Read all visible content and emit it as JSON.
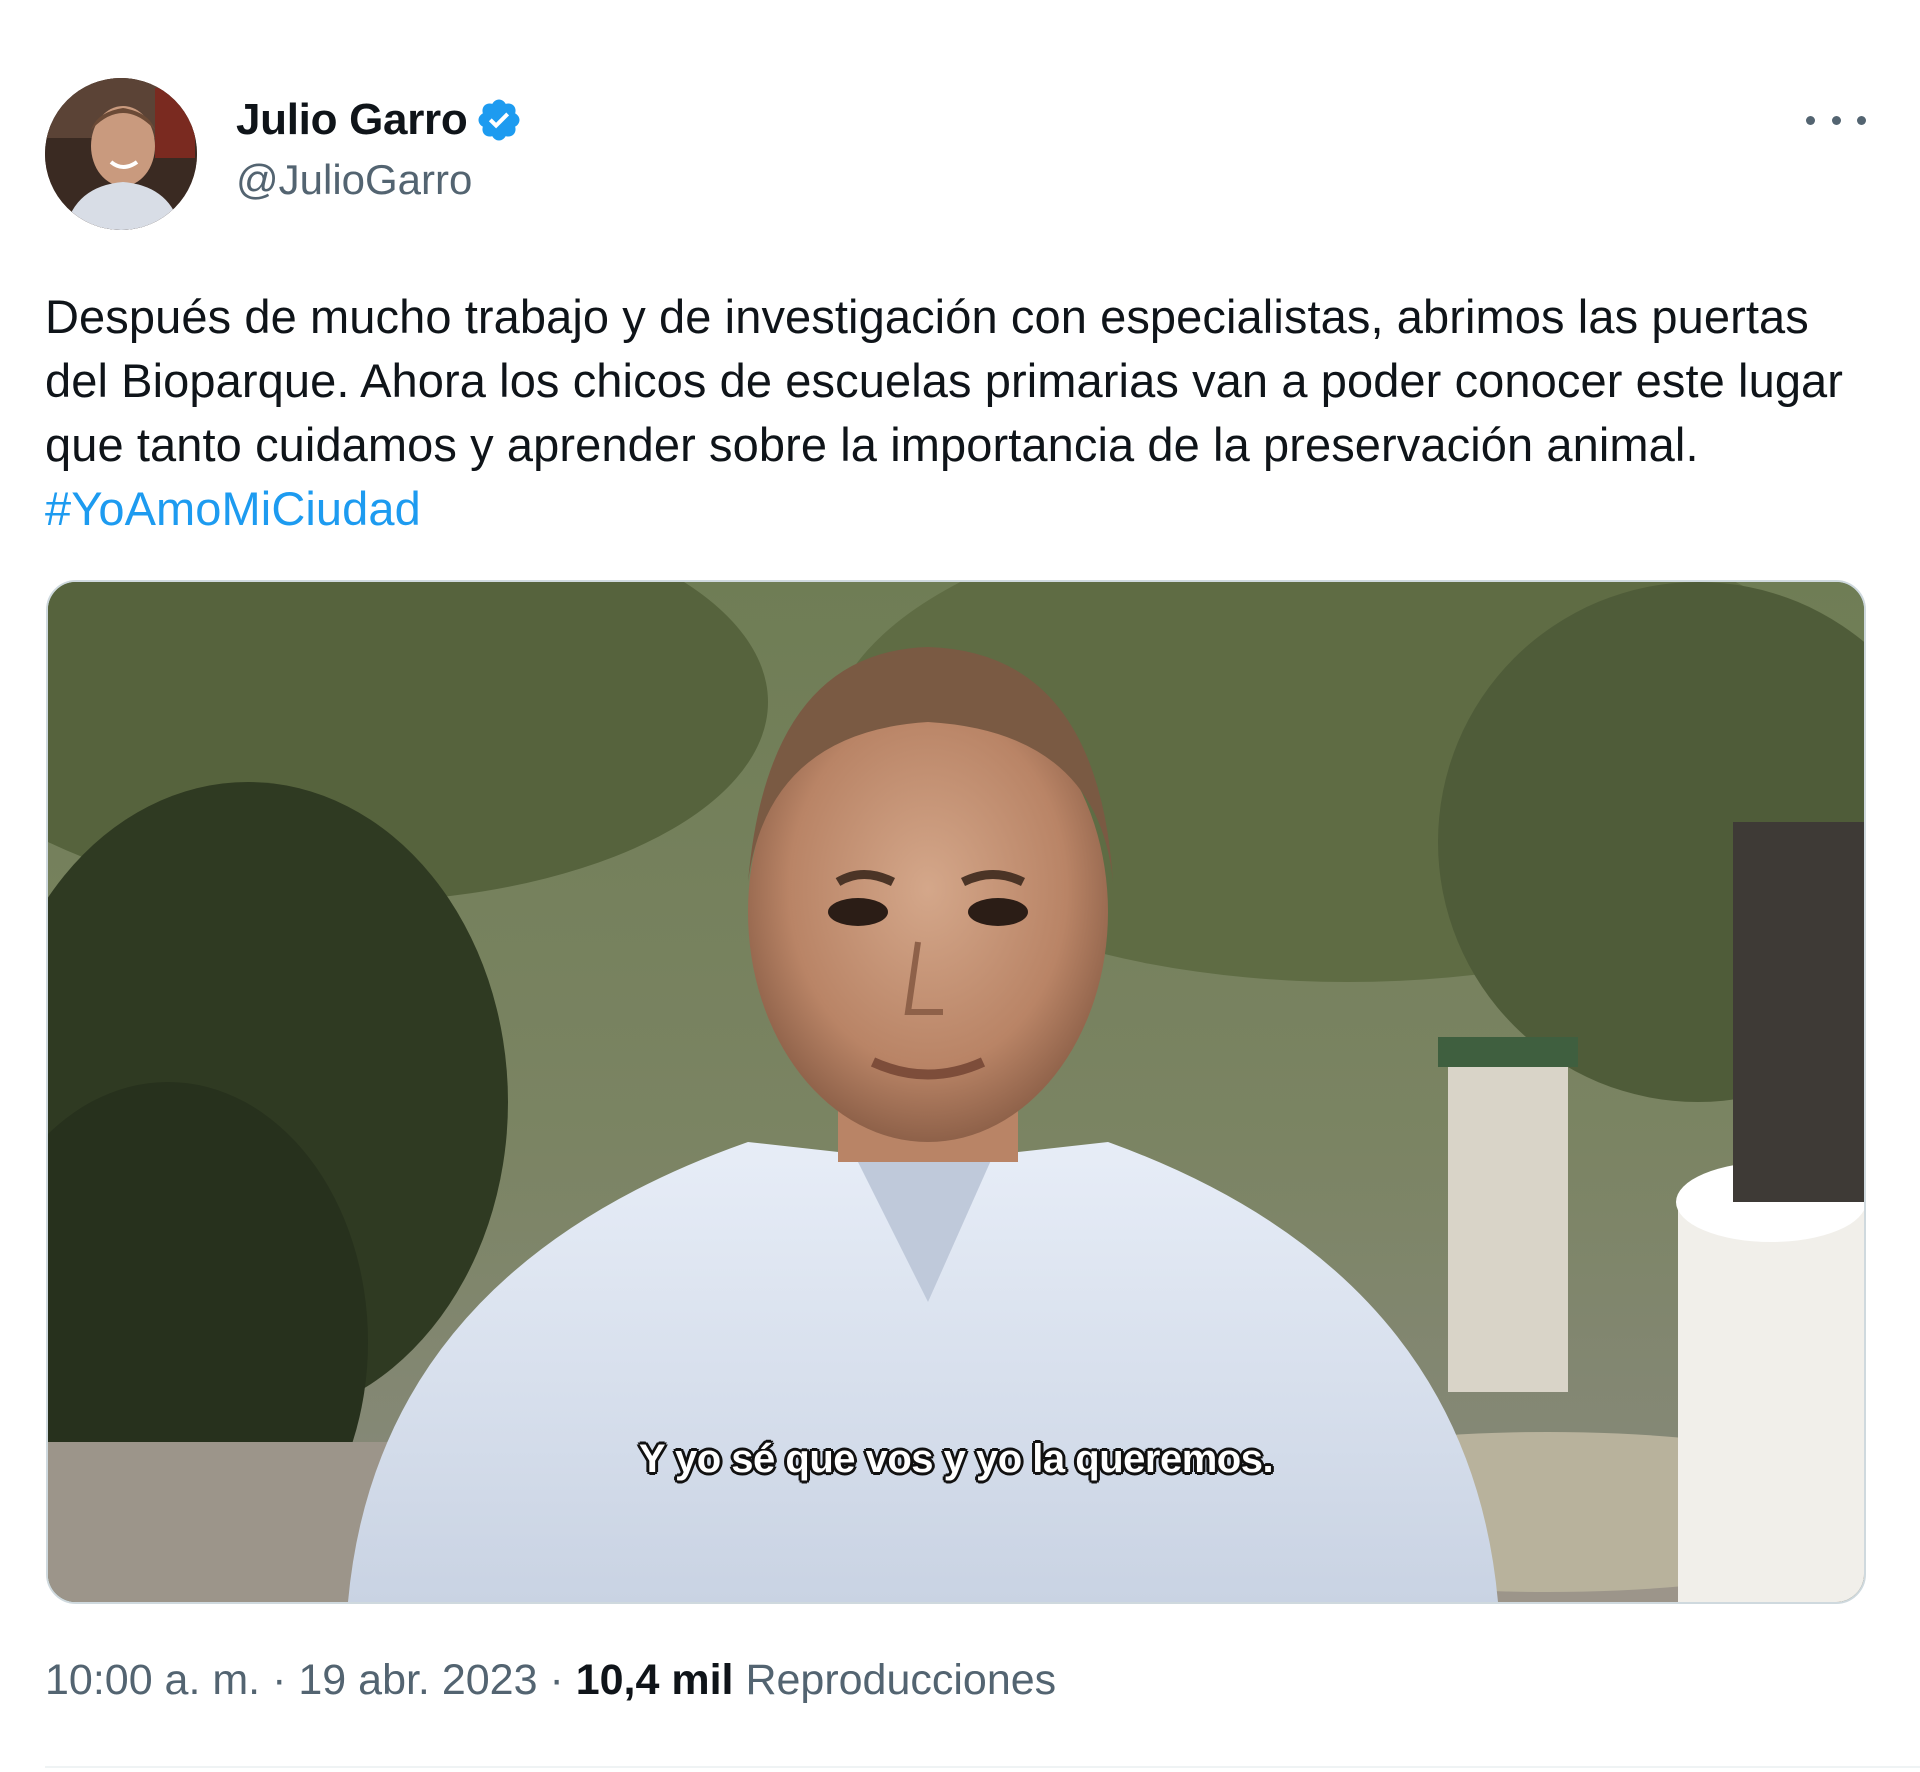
{
  "tweet": {
    "author": {
      "display_name": "Julio Garro",
      "handle": "@JulioGarro",
      "verified": true,
      "avatar_icon": "profile-photo"
    },
    "more_icon": "more-horizontal-icon",
    "text": "Después de mucho trabajo y de investigación con especialistas, abrimos las puertas del Bioparque. Ahora los chicos de escuelas primarias van a poder conocer este lugar que tanto cuidamos y aprender sobre la importancia de la preservación animal. ",
    "hashtag": "#YoAmoMiCiudad",
    "media": {
      "type": "video",
      "subtitle": "Y yo sé que vos y yo la queremos."
    },
    "meta": {
      "time": "10:00 a. m.",
      "separator": "·",
      "date": "19 abr. 2023",
      "views_count": "10,4 mil",
      "views_label": "Reproducciones"
    },
    "colors": {
      "accent": "#1d9bf0",
      "text": "#0f1419",
      "secondary_text": "#536471"
    }
  }
}
